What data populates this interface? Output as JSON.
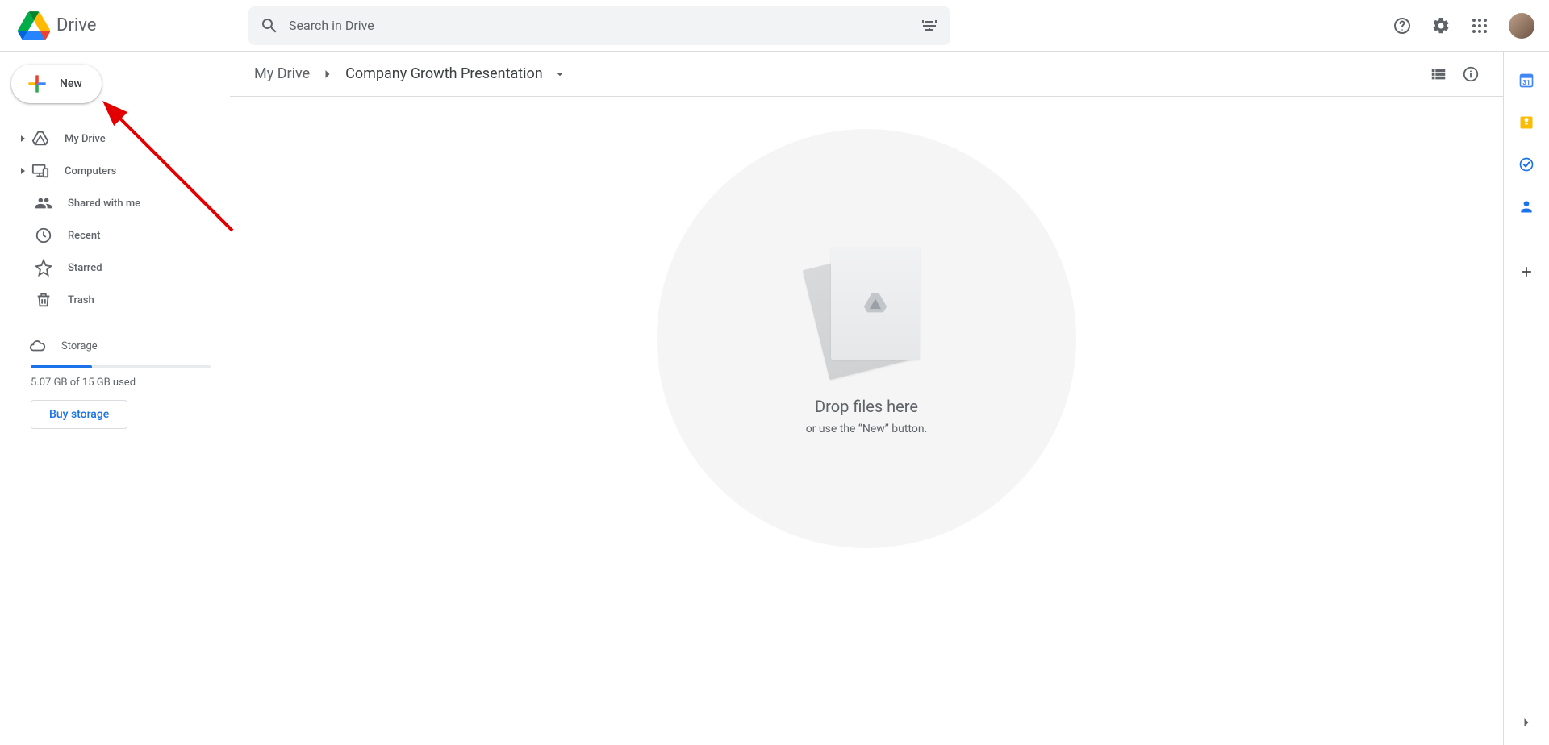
{
  "header": {
    "product_name": "Drive",
    "search_placeholder": "Search in Drive"
  },
  "sidebar": {
    "new_label": "New",
    "items": [
      {
        "label": "My Drive",
        "expandable": true
      },
      {
        "label": "Computers",
        "expandable": true
      },
      {
        "label": "Shared with me",
        "expandable": false
      },
      {
        "label": "Recent",
        "expandable": false
      },
      {
        "label": "Starred",
        "expandable": false
      },
      {
        "label": "Trash",
        "expandable": false
      }
    ],
    "storage": {
      "label": "Storage",
      "usage_text": "5.07 GB of 15 GB used",
      "buy_label": "Buy storage"
    }
  },
  "breadcrumb": {
    "root": "My Drive",
    "current": "Company Growth Presentation"
  },
  "empty_state": {
    "title": "Drop files here",
    "subtitle": "or use the “New” button."
  }
}
